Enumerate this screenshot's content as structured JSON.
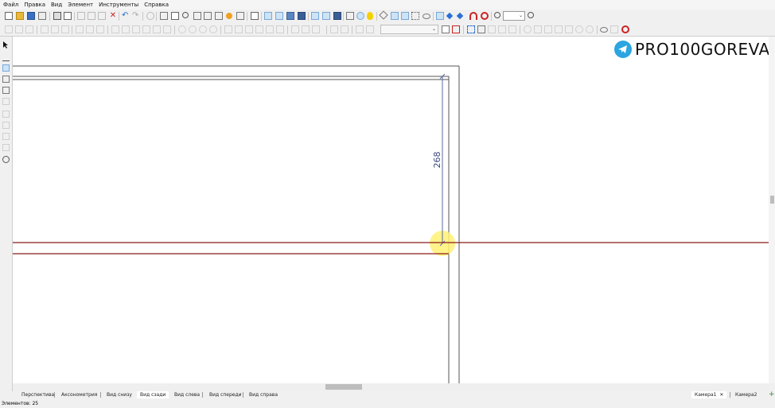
{
  "menu": [
    "Файл",
    "Правка",
    "Вид",
    "Элемент",
    "Инструменты",
    "Справка"
  ],
  "drawing": {
    "dimension_value": "268"
  },
  "watermark": {
    "text": "PRO100GOREVA",
    "icon": "telegram-icon"
  },
  "view_tabs": [
    "Перспектива",
    "Аксонометрия",
    "Вид снизу",
    "Вид сзади",
    "Вид слева",
    "Вид спереди",
    "Вид справа"
  ],
  "active_view_tab": "Вид сзади",
  "camera_tabs": [
    "Камера1",
    "Камера2"
  ],
  "close_glyph": "✕",
  "add_glyph": "+",
  "status": {
    "elements": "Элементов: 25"
  },
  "colors": {
    "accent_blue": "#2a6fd6",
    "selected_button": "#cce4f7",
    "red_line": "#8b1a1a",
    "wall_line": "#555555",
    "dimension_line": "#5a6aa0",
    "cursor_highlight": "#fff176",
    "telegram_blue": "#2ca5e0"
  }
}
